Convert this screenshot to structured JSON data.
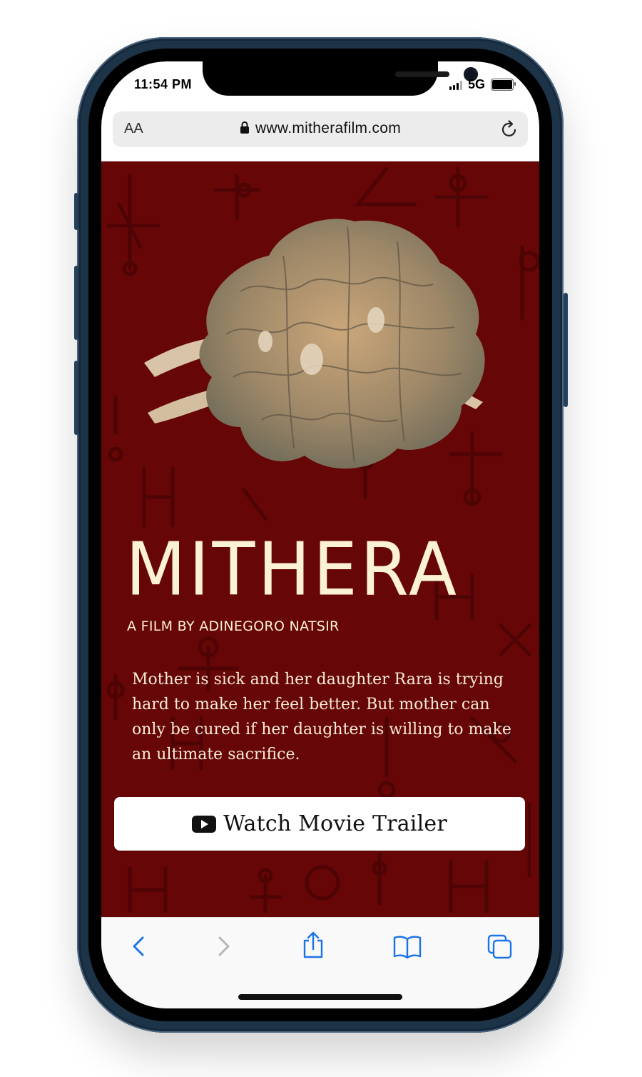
{
  "status_bar": {
    "time": "11:54 PM",
    "network": "5G"
  },
  "browser": {
    "text_size_button": "AA",
    "url": "www.mitherafilm.com",
    "icons": {
      "lock": "lock-icon",
      "reload": "reload-icon",
      "back": "chevron-left-icon",
      "forward": "chevron-right-icon",
      "share": "share-icon",
      "bookmarks": "book-icon",
      "tabs": "tabs-icon"
    }
  },
  "page": {
    "title_logo": "MITHERA",
    "byline": "A FILM BY ADINEGORO NATSIR",
    "synopsis": "Mother is sick and her daughter Rara is trying hard to make her feel better. But mother can only be cured if her daughter is willing to make an ultimate sacrifice.",
    "trailer_button": {
      "label": "Watch Movie Trailer",
      "icon": "youtube-icon"
    }
  },
  "colors": {
    "background": "#670607",
    "title_text": "#fbf2d3",
    "button_bg": "#ffffff",
    "ios_blue": "#1a73e8",
    "disabled_gray": "#b5b5b5"
  }
}
